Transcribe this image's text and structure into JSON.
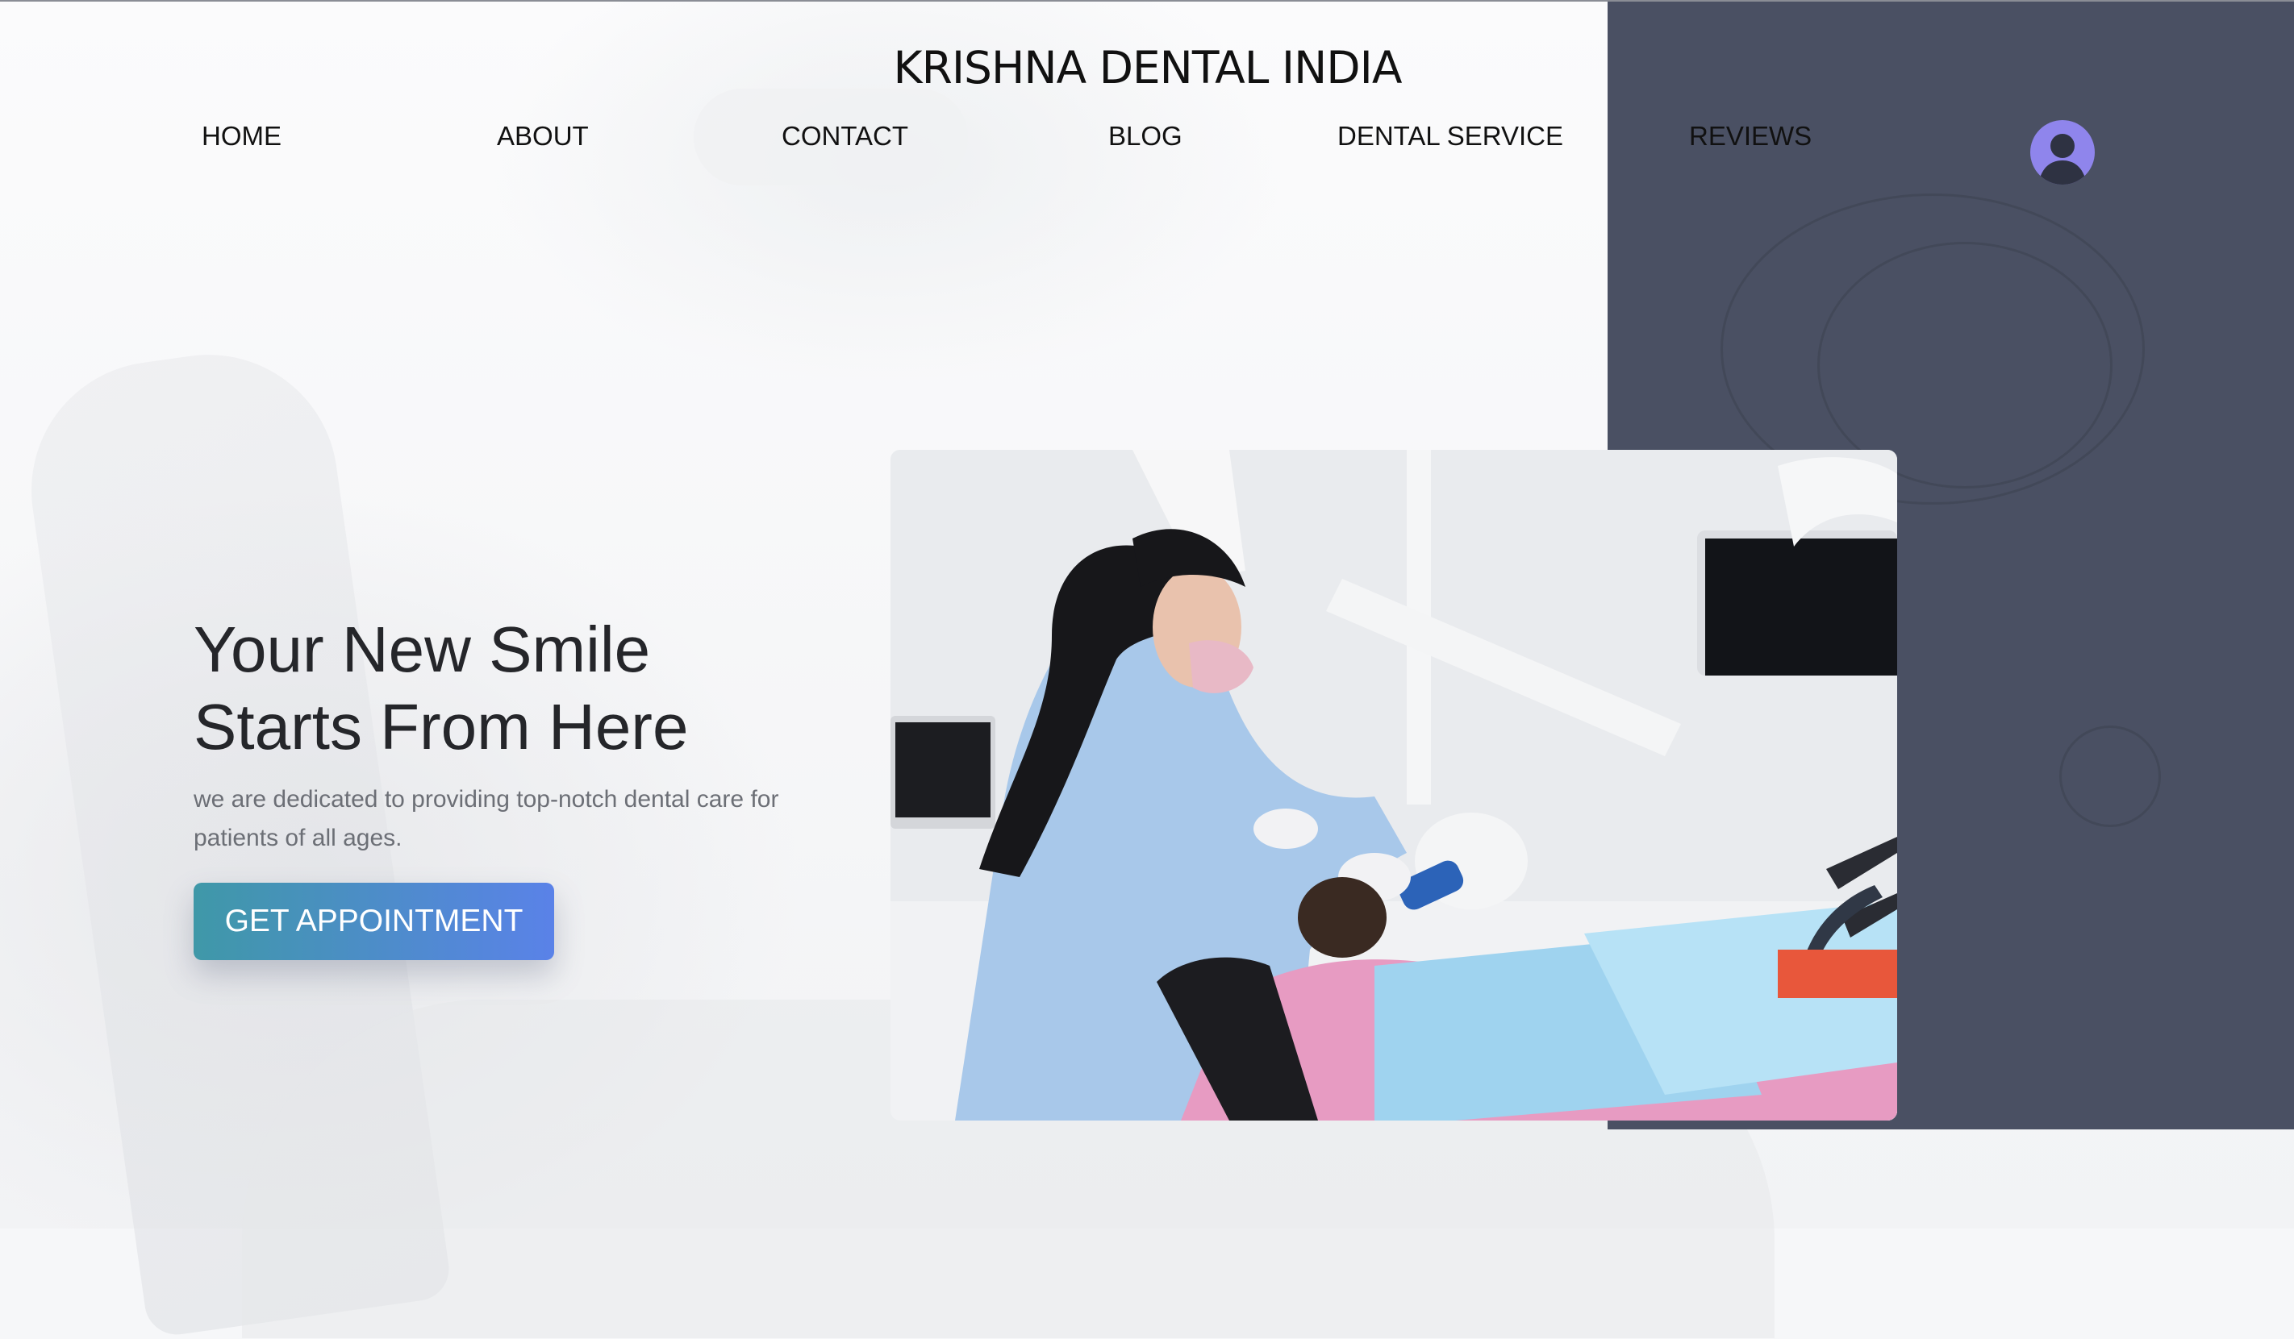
{
  "site": {
    "title": "KRISHNA DENTAL INDIA"
  },
  "nav": {
    "items": [
      {
        "label": "HOME"
      },
      {
        "label": "ABOUT"
      },
      {
        "label": "CONTACT"
      },
      {
        "label": "BLOG"
      },
      {
        "label": "DENTAL SERVICE"
      },
      {
        "label": "REVIEWS"
      }
    ],
    "avatar_icon": "user-avatar-icon"
  },
  "hero": {
    "heading_line1": "Your New Smile",
    "heading_line2": "Starts From Here",
    "subtitle": "we are dedicated to providing top-notch dental care for patients of all ages.",
    "cta_label": "GET APPOINTMENT",
    "photo_alt": "dentist-treating-patient-photo"
  },
  "colors": {
    "dark_panel": "#4a5063",
    "avatar": "#8f85ec",
    "cta_gradient_start": "#3f98a8",
    "cta_gradient_end": "#5a82e8"
  }
}
